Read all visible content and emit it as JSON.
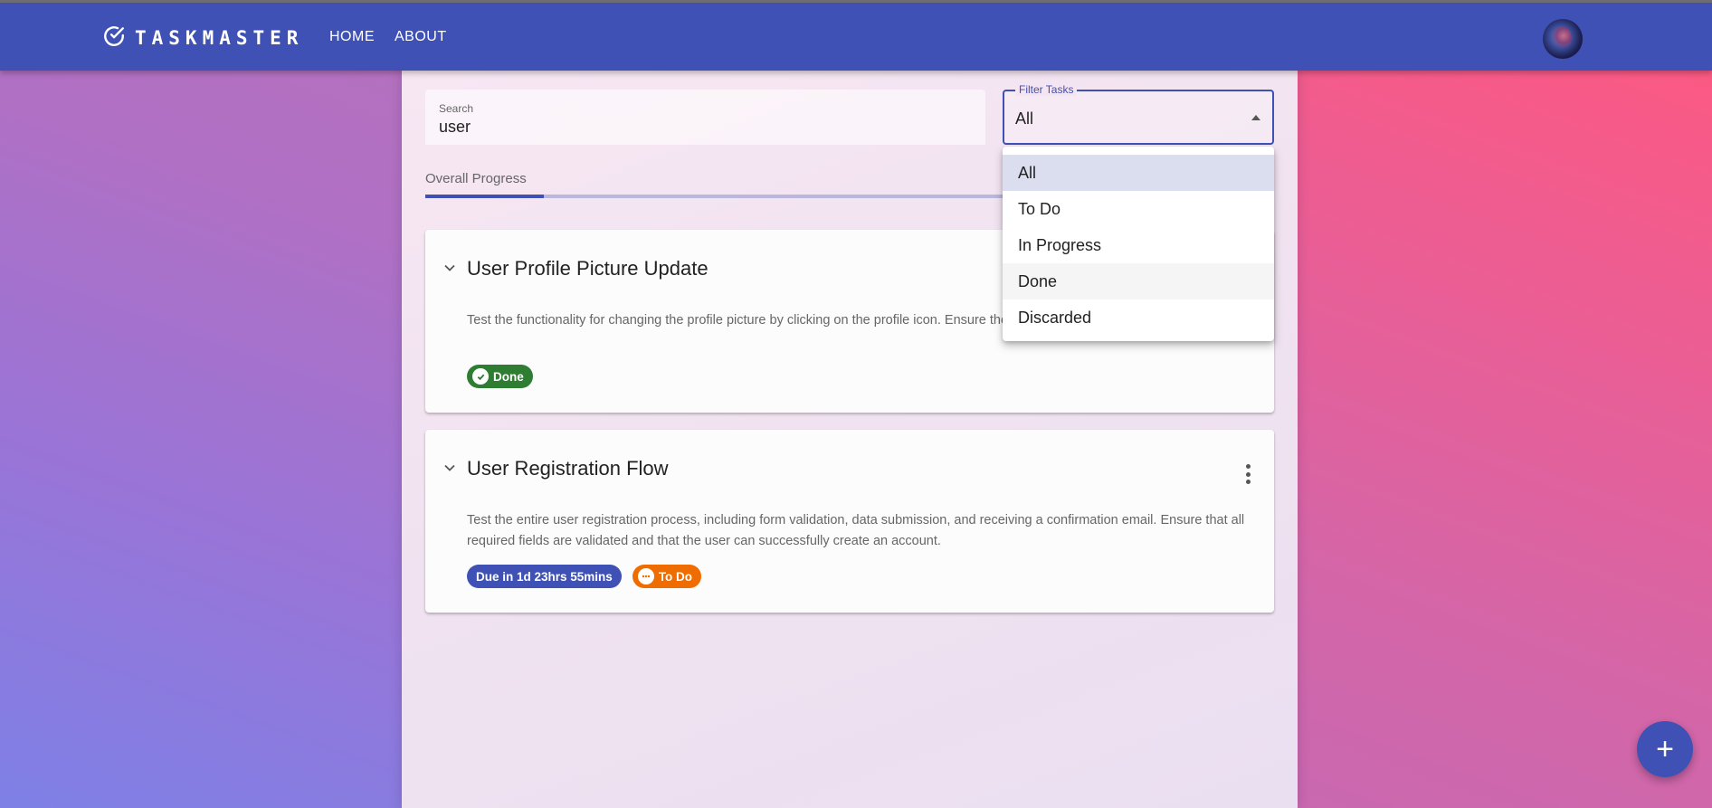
{
  "app": {
    "logo_text": "TASKMASTER",
    "logo_icon": "check-circle-icon",
    "nav": [
      {
        "label": "HOME"
      },
      {
        "label": "ABOUT"
      }
    ],
    "avatar_icon": "user-avatar"
  },
  "search": {
    "label": "Search",
    "value": "user"
  },
  "filter": {
    "label": "Filter Tasks",
    "value": "All",
    "options": [
      "All",
      "To Do",
      "In Progress",
      "Done",
      "Discarded"
    ]
  },
  "progress": {
    "label": "Overall Progress",
    "percent": 14
  },
  "tasks": [
    {
      "title": "User Profile Picture Update",
      "description": "Test the functionality for changing the profile picture by clicking on the profile icon. Ensure the new profile picture is uploaded and displayed correctly, similar to Facebook's profile picture update process.",
      "status": "Done",
      "status_icon": "check-circle-icon",
      "status_color": "#2e7d32"
    },
    {
      "title": "User Registration Flow",
      "description": "Test the entire user registration process, including form validation, data submission, and receiving a confirmation email. Ensure that all required fields are validated and that the user can successfully create an account.",
      "due": "Due in 1d 23hrs 55mins",
      "status": "To Do",
      "status_icon": "more-horizontal-circle-icon",
      "status_color": "#ef6c00"
    }
  ],
  "fab_label": "+",
  "colors": {
    "primary": "#3f51b5",
    "done": "#2e7d32",
    "todo": "#ef6c00"
  }
}
